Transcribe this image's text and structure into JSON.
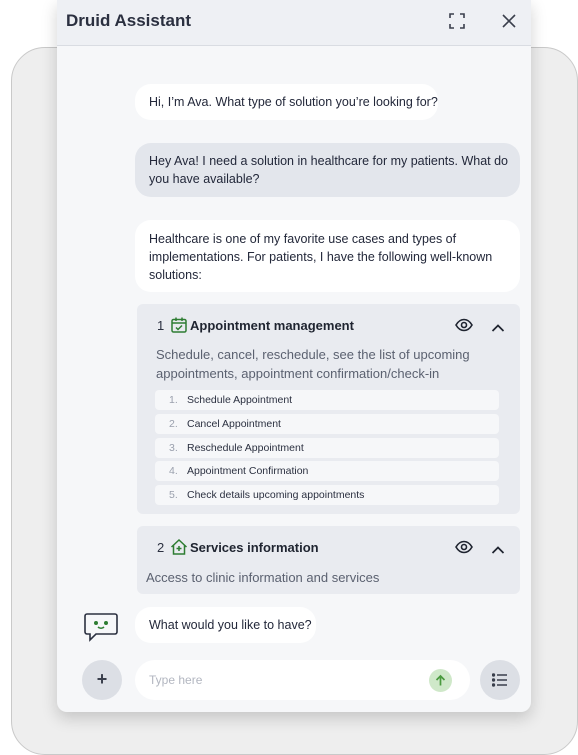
{
  "header": {
    "title": "Druid Assistant",
    "icons": [
      "expand-icon",
      "close-icon"
    ]
  },
  "messages": [
    {
      "role": "bot",
      "text": "Hi, I’m Ava. What type of solution you’re looking for?"
    },
    {
      "role": "user",
      "lines": [
        "Hey Ava! I need a solution in healthcare for my patients. What do",
        "you have available?"
      ]
    },
    {
      "role": "bot",
      "lines": [
        "Healthcare is one of my favorite use cases and types of",
        "implementations. For patients, I have the following well-known",
        "solutions:"
      ]
    }
  ],
  "solutions": [
    {
      "number": "1",
      "icon": "calendar-check-icon",
      "title": "Appointment management",
      "description": [
        "Schedule, cancel, reschedule, see the list of upcoming",
        "appointments, appointment confirmation/check-in"
      ],
      "items": [
        {
          "num": "1.",
          "label": "Schedule Appointment"
        },
        {
          "num": "2.",
          "label": "Cancel Appointment"
        },
        {
          "num": "3.",
          "label": "Reschedule Appointment"
        },
        {
          "num": "4.",
          "label": "Appointment Confirmation"
        },
        {
          "num": "5.",
          "label": "Check details upcoming appointments"
        }
      ]
    },
    {
      "number": "2",
      "icon": "clinic-house-icon",
      "title": "Services information",
      "description": [
        "Access to clinic information and services"
      ]
    }
  ],
  "final_message": "What would you like to have?",
  "composer": {
    "placeholder": "Type here",
    "add_icon": "+",
    "colors": {
      "send": "#cfe8c9",
      "send_arrow": "#4a9a3e",
      "accent": "#2e7d32"
    }
  }
}
